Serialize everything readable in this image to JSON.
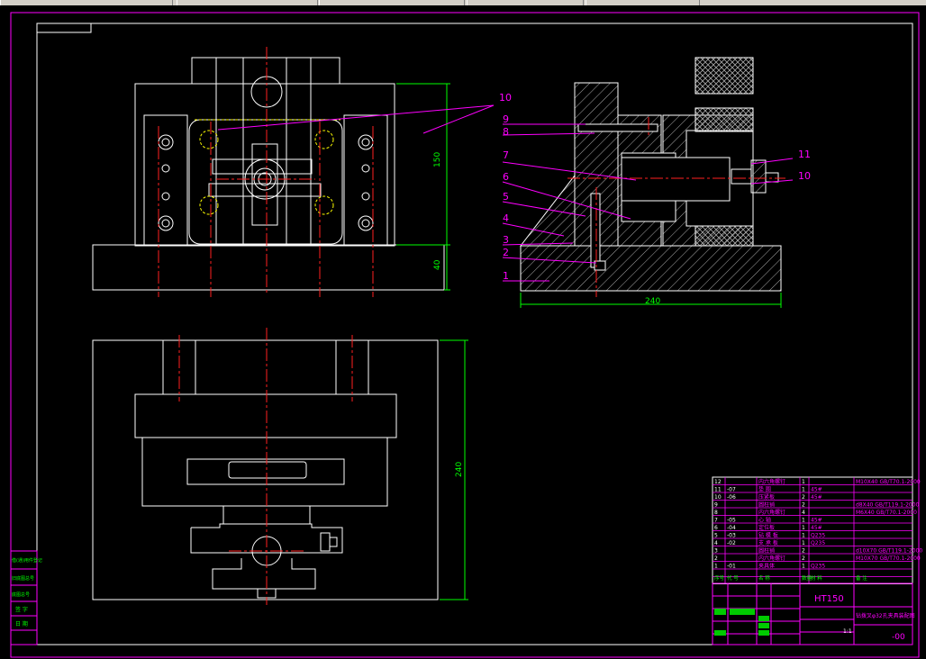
{
  "part_labels_front": [
    "10"
  ],
  "part_labels_side": [
    "9",
    "8",
    "7",
    "6",
    "5",
    "4",
    "3",
    "2",
    "1"
  ],
  "part_labels_right": [
    "11",
    "10"
  ],
  "dimensions": {
    "height_150": "150",
    "height_40": "40",
    "width_240": "240",
    "height_240": "240"
  },
  "bom": {
    "rows": [
      {
        "no": "12",
        "code": "",
        "name": "内六角螺钉",
        "qty": "1",
        "material": "",
        "std": "M10X40 GB/T70.1-2000"
      },
      {
        "no": "11",
        "code": "-07",
        "name": "垫 圈",
        "qty": "1",
        "material": "45#",
        "std": ""
      },
      {
        "no": "10",
        "code": "-06",
        "name": "压紧板",
        "qty": "2",
        "material": "45#",
        "std": ""
      },
      {
        "no": "9",
        "code": "",
        "name": "圆柱销",
        "qty": "2",
        "material": "",
        "std": "d8X40 GB/T119.1-2000"
      },
      {
        "no": "8",
        "code": "",
        "name": "内六角螺钉",
        "qty": "4",
        "material": "",
        "std": "M6X40 GB/T70.1-2000"
      },
      {
        "no": "7",
        "code": "-05",
        "name": "心 轴",
        "qty": "1",
        "material": "45#",
        "std": ""
      },
      {
        "no": "6",
        "code": "-04",
        "name": "定位板",
        "qty": "1",
        "material": "45#",
        "std": ""
      },
      {
        "no": "5",
        "code": "-03",
        "name": "钻 模 板",
        "qty": "1",
        "material": "Q235",
        "std": ""
      },
      {
        "no": "4",
        "code": "-02",
        "name": "支 承 板",
        "qty": "1",
        "material": "Q235",
        "std": ""
      },
      {
        "no": "3",
        "code": "",
        "name": "圆柱销",
        "qty": "2",
        "material": "",
        "std": "d10X70 GB/T119.1-2000"
      },
      {
        "no": "2",
        "code": "",
        "name": "内六角螺钉",
        "qty": "2",
        "material": "",
        "std": "M10X70 GB/T70.1-2000"
      },
      {
        "no": "1",
        "code": "-01",
        "name": "夹具体",
        "qty": "1",
        "material": "Q235",
        "std": ""
      }
    ],
    "header": [
      "序号",
      "代 号",
      "名 称",
      "数量",
      "材 料",
      "备 注"
    ],
    "material_title": "HT150",
    "drawing_title": "钻拨叉φ32孔夹具装配图",
    "drawing_no": "-00",
    "scale": "1:1"
  },
  "left_stamp": [
    "借(通)用件登记",
    "旧底图总号",
    "底图总号",
    "签 字",
    "日 期"
  ],
  "colors": {
    "line": "#ffffff",
    "center": "#ff2020",
    "magenta": "#ff00ff",
    "green": "#00ff00",
    "yellow": "#ffff00",
    "hatch": "#b0b0b0"
  }
}
